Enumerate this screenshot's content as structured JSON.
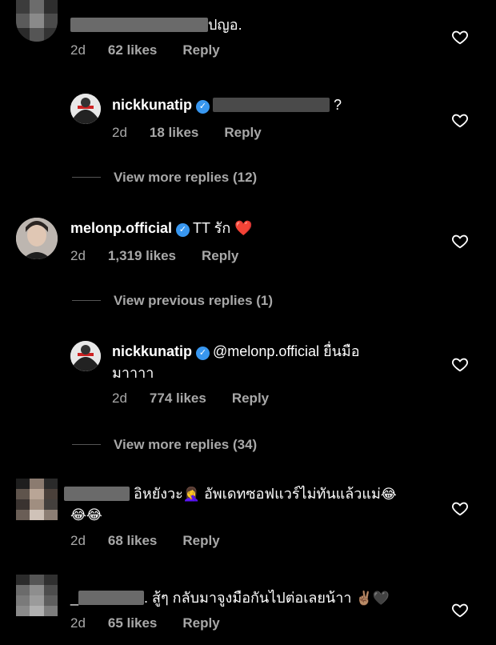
{
  "comments": [
    {
      "text_tail": "ปญอ.",
      "time": "2d",
      "likes": "62 likes",
      "reply": "Reply"
    },
    {
      "username": "nickkunatip",
      "text_tail": "?",
      "time": "2d",
      "likes": "18 likes",
      "reply": "Reply"
    },
    {
      "username": "melonp.official",
      "text": "TT รัก",
      "emoji": "❤️",
      "time": "2d",
      "likes": "1,319 likes",
      "reply": "Reply"
    },
    {
      "username": "nickkunatip",
      "mention": "@melonp.official",
      "text_line1": "ยื่นมือ",
      "text_line2": "มาาาา",
      "time": "2d",
      "likes": "774 likes",
      "reply": "Reply"
    },
    {
      "text_start": "อิหยังวะ",
      "emoji1": "🤦‍♀️",
      "text_middle": "อัพเดทซอฟแวร์ไม่ทันแล้วแม่",
      "emoji2": "😂",
      "text_line2": "😂😂",
      "time": "2d",
      "likes": "68 likes",
      "reply": "Reply"
    },
    {
      "text_start": "_",
      "text_middle": ". สู้ๆ กลับมาจูงมือกันไปต่อเลยน้าา",
      "emoji": "✌🏽🖤",
      "time": "2d",
      "likes": "65 likes",
      "reply": "Reply"
    }
  ],
  "view_more_1": "View more replies (12)",
  "view_previous": "View previous replies (1)",
  "view_more_2": "View more replies (34)",
  "verified_glyph": "✓",
  "icons": {
    "like": "heart-outline-icon",
    "verified": "verified-badge-icon"
  },
  "colors": {
    "background": "#000000",
    "meta": "#a8a8a8",
    "verified": "#3897f0",
    "heart": "#ed4956"
  }
}
